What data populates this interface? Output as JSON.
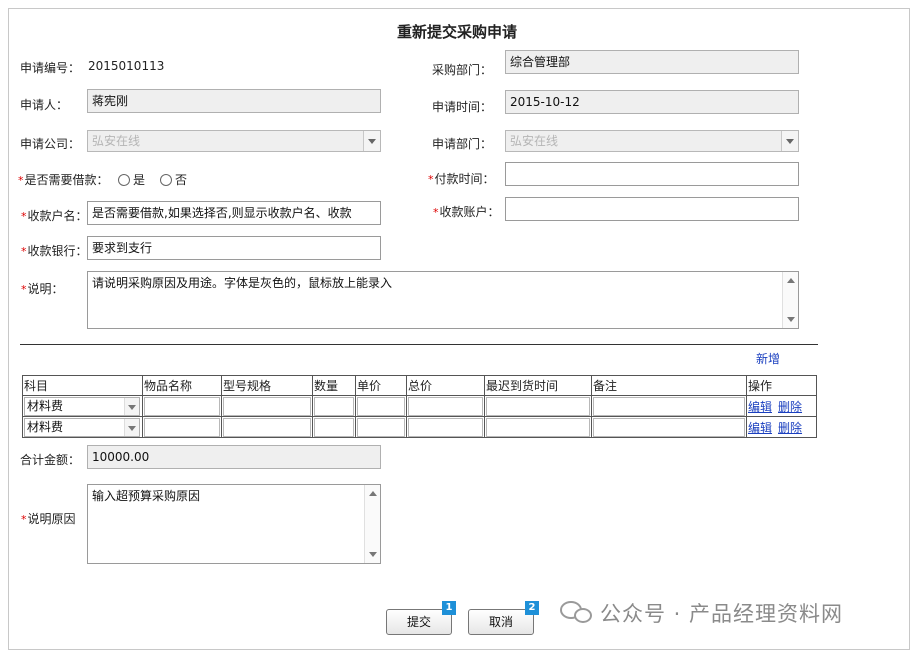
{
  "page": {
    "title": "重新提交采购申请"
  },
  "form": {
    "apply_no_label": "申请编号：",
    "apply_no_value": "2015010113",
    "purchase_dept_label": "采购部门：",
    "purchase_dept_value": "综合管理部",
    "applicant_label": "申请人：",
    "applicant_value": "蒋宪刚",
    "apply_time_label": "申请时间：",
    "apply_time_value": "2015-10-12",
    "company_label": "申请公司：",
    "company_value": "弘安在线",
    "dept_label": "申请部门：",
    "dept_value": "弘安在线",
    "loan_label": "是否需要借款：",
    "loan_yes": "是",
    "loan_no": "否",
    "pay_time_label": "付款时间：",
    "pay_time_value": "",
    "payee_name_label": "收款户名：",
    "payee_name_value": "是否需要借款,如果选择否,则显示收款户名、收款",
    "payee_account_label": "收款账户：",
    "payee_account_value": "",
    "bank_label": "收款银行：",
    "bank_value": "要求到支行",
    "desc_label": "说明：",
    "desc_value": "请说明采购原因及用途。字体是灰色的，鼠标放上能录入",
    "required_mark": "*"
  },
  "items": {
    "add_label": "新增",
    "headers": [
      "科目",
      "物品名称",
      "型号规格",
      "数量",
      "单价",
      "总价",
      "最迟到货时间",
      "备注",
      "操作"
    ],
    "rows": [
      {
        "subject": "材料费",
        "edit": "编辑",
        "delete": "删除"
      },
      {
        "subject": "材料费",
        "edit": "编辑",
        "delete": "删除"
      }
    ]
  },
  "totals": {
    "total_label": "合计金额：",
    "total_value": "10000.00",
    "reason_label": "说明原因",
    "reason_value": "输入超预算采购原因"
  },
  "actions": {
    "submit_label": "提交",
    "submit_badge": "1",
    "cancel_label": "取消",
    "cancel_badge": "2"
  },
  "watermark": {
    "text": "公众号 · 产品经理资料网"
  }
}
